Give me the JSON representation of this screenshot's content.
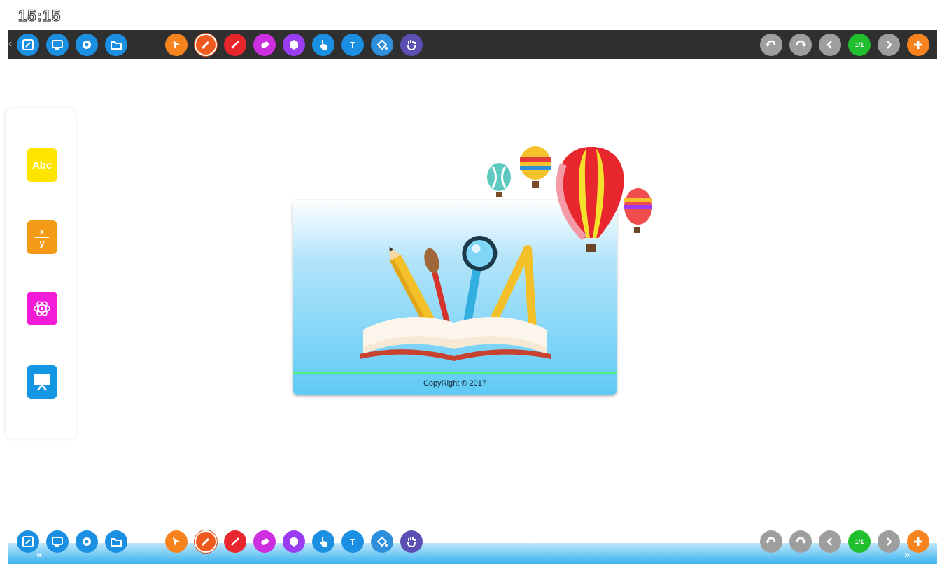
{
  "clock": "15:15",
  "toolbar": {
    "left_buttons": [
      {
        "name": "edit-icon",
        "color": "#1b8fe2"
      },
      {
        "name": "screen-icon",
        "color": "#1b8fe2"
      },
      {
        "name": "settings-icon",
        "color": "#1b8fe2"
      },
      {
        "name": "folder-icon",
        "color": "#1b8fe2"
      }
    ],
    "tool_buttons": [
      {
        "name": "select-icon",
        "color": "#f7831f"
      },
      {
        "name": "pen-icon",
        "color": "#ef5a1f",
        "active": true
      },
      {
        "name": "line-icon",
        "color": "#e8262e"
      },
      {
        "name": "eraser-icon",
        "color": "#cc2ee0"
      },
      {
        "name": "shape-icon",
        "color": "#9a3df2"
      },
      {
        "name": "hand-pointer-icon",
        "color": "#1b8fe2"
      },
      {
        "name": "text-icon",
        "color": "#1b8fe2",
        "label": "T"
      },
      {
        "name": "fill-icon",
        "color": "#2e8fdc"
      },
      {
        "name": "palm-icon",
        "color": "#5b4fb4"
      }
    ],
    "right_buttons": [
      {
        "name": "undo-icon",
        "color": "#9e9e9e"
      },
      {
        "name": "redo-icon",
        "color": "#9e9e9e"
      },
      {
        "name": "prev-page-icon",
        "color": "#9e9e9e"
      },
      {
        "name": "page-indicator",
        "color": "#1fbf2e",
        "label": "1/1"
      },
      {
        "name": "next-page-icon",
        "color": "#9e9e9e"
      },
      {
        "name": "add-page-icon",
        "color": "#f7831f"
      }
    ],
    "collapse_left": "«",
    "collapse_right": "»"
  },
  "sidebar": {
    "abc_label": "Abc",
    "frac_top": "x",
    "frac_bottom": "y"
  },
  "card": {
    "copyright": "CopyRight ® 2017"
  }
}
